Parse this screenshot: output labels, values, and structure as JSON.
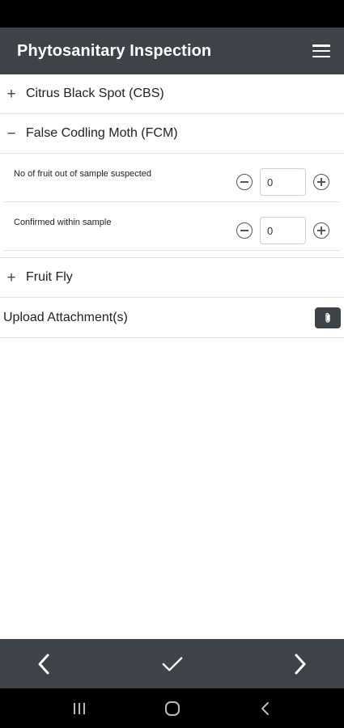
{
  "header": {
    "title": "Phytosanitary Inspection",
    "menu_icon": "hamburger-menu-icon"
  },
  "accordion": {
    "cbs": {
      "sign": "+",
      "label": "Citrus Black Spot (CBS)",
      "expanded": false
    },
    "fcm": {
      "sign": "−",
      "label": "False Codling Moth (FCM)",
      "expanded": true,
      "fields": [
        {
          "label": "No of fruit out of sample suspected",
          "value": "0"
        },
        {
          "label": "Confirmed within sample",
          "value": "0"
        }
      ]
    },
    "fruit_fly": {
      "sign": "+",
      "label": "Fruit Fly",
      "expanded": false
    }
  },
  "upload": {
    "label": "Upload Attachment(s)",
    "icon": "paperclip-icon"
  },
  "footer": {
    "back_icon": "chevron-left-icon",
    "confirm_icon": "checkmark-icon",
    "next_icon": "chevron-right-icon"
  },
  "system_nav": {
    "recents_icon": "recents-icon",
    "home_icon": "home-icon",
    "back_icon": "back-icon"
  },
  "colors": {
    "header_bg": "#3e4349",
    "footer_bg": "#3e4349",
    "divider": "#e2e2e2"
  }
}
